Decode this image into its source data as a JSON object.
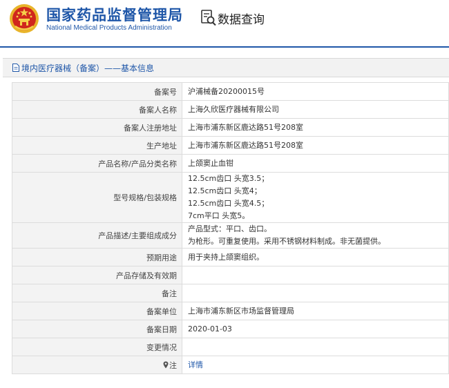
{
  "header": {
    "agency_cn": "国家药品监督管理局",
    "agency_en": "National Medical Products Administration",
    "query_title": "数据查询"
  },
  "breadcrumb": "境内医疗器械（备案）——基本信息",
  "record": {
    "rows": [
      {
        "label": "备案号",
        "value": "沪浦械备20200015号"
      },
      {
        "label": "备案人名称",
        "value": "上海久欣医疗器械有限公司"
      },
      {
        "label": "备案人注册地址",
        "value": "上海市浦东新区鹿达路51号208室"
      },
      {
        "label": "生产地址",
        "value": "上海市浦东新区鹿达路51号208室"
      },
      {
        "label": "产品名称/产品分类名称",
        "value": "上颌窦止血钳"
      },
      {
        "label": "型号规格/包装规格",
        "lines": [
          "12.5cm齿口 头宽3.5；",
          "12.5cm齿口 头宽4；",
          "12.5cm齿口 头宽4.5；",
          "7cm平口 头宽5。"
        ]
      },
      {
        "label": "产品描述/主要组成成分",
        "lines": [
          "产品型式：平口、齿口。",
          "为枪形。可重复使用。采用不锈钢材料制成。非无菌提供。"
        ]
      },
      {
        "label": "预期用途",
        "value": "用于夹持上颌窦组织。"
      },
      {
        "label": "产品存储及有效期",
        "value": ""
      },
      {
        "label": "备注",
        "value": ""
      },
      {
        "label": "备案单位",
        "value": "上海市浦东新区市场监督管理局"
      },
      {
        "label": "备案日期",
        "value": "2020-01-03"
      },
      {
        "label": "变更情况",
        "value": ""
      },
      {
        "label": "注",
        "value": "详情"
      }
    ]
  },
  "colors": {
    "brand_blue": "#1e56a8",
    "emblem_red": "#d0271d",
    "emblem_gold": "#e8b42a"
  },
  "icons": [
    "national-emblem-icon",
    "data-query-icon",
    "document-icon",
    "map-pin-icon"
  ]
}
